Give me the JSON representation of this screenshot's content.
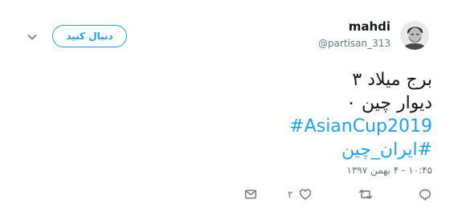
{
  "header": {
    "display_name": "mahdi",
    "handle": "@partisan_313",
    "follow_label": "دنبال کنید"
  },
  "tweet": {
    "line1": "برج میلاد ۳",
    "line2": "دیوار چین ۰",
    "hashtag1": "#AsianCup2019",
    "hashtag2": "#ایران_چین",
    "timestamp": "۱۰:۴۵ - ۴ بهمن ۱۳۹۷"
  },
  "actions": {
    "like_count": "۲"
  },
  "colors": {
    "accent": "#1da1f2",
    "muted": "#657786",
    "text": "#14171a"
  },
  "icons": [
    "avatar-photo",
    "chevron-down-icon",
    "reply-icon",
    "retweet-icon",
    "heart-icon",
    "envelope-icon"
  ]
}
